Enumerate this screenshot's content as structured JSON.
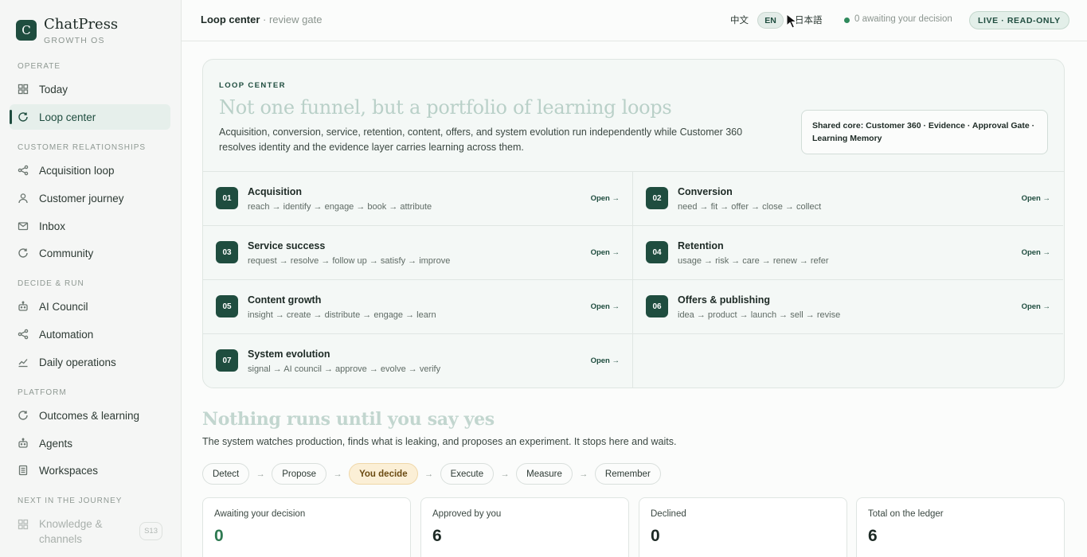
{
  "brand": {
    "logo_letter": "C",
    "name": "ChatPress",
    "sub": "GROWTH OS"
  },
  "sidebar": {
    "sections": [
      {
        "title": "OPERATE"
      },
      {
        "title": "CUSTOMER RELATIONSHIPS"
      },
      {
        "title": "DECIDE & RUN"
      },
      {
        "title": "PLATFORM"
      },
      {
        "title": "NEXT IN THE JOURNEY"
      }
    ],
    "items": [
      {
        "label": "Today",
        "icon": "grid-icon"
      },
      {
        "label": "Loop center",
        "icon": "refresh-icon",
        "active": true
      },
      {
        "label": "Acquisition loop",
        "icon": "share-icon"
      },
      {
        "label": "Customer journey",
        "icon": "user-icon"
      },
      {
        "label": "Inbox",
        "icon": "mail-icon"
      },
      {
        "label": "Community",
        "icon": "refresh-icon"
      },
      {
        "label": "AI Council",
        "icon": "robot-icon"
      },
      {
        "label": "Automation",
        "icon": "share-icon"
      },
      {
        "label": "Daily operations",
        "icon": "trend-icon"
      },
      {
        "label": "Outcomes & learning",
        "icon": "refresh-icon"
      },
      {
        "label": "Agents",
        "icon": "robot-icon"
      },
      {
        "label": "Workspaces",
        "icon": "document-icon"
      },
      {
        "label": "Knowledge & channels",
        "icon": "grid-icon",
        "badge": "S13",
        "disabled": true
      }
    ]
  },
  "topbar": {
    "crumb_title": "Loop center",
    "crumb_sub": " · review gate",
    "lang_zh": "中文",
    "lang_en": "EN",
    "lang_ja": "日本語",
    "status_text": "0 awaiting your decision",
    "mode_pill": "LIVE · READ-ONLY"
  },
  "hero": {
    "eyebrow": "LOOP CENTER",
    "title": "Not one funnel, but a portfolio of learning loops",
    "description": "Acquisition, conversion, service, retention, content, offers, and system evolution run independently while Customer 360 resolves identity and the evidence layer carries learning across them.",
    "core": "Shared core: Customer 360 · Evidence · Approval Gate · Learning Memory",
    "loops": [
      {
        "num": "01",
        "name": "Acquisition",
        "steps": "reach → identify → engage → book → attribute",
        "open": "Open →"
      },
      {
        "num": "02",
        "name": "Conversion",
        "steps": "need → fit → offer → close → collect",
        "open": "Open →"
      },
      {
        "num": "03",
        "name": "Service success",
        "steps": "request → resolve → follow up → satisfy → improve",
        "open": "Open →"
      },
      {
        "num": "04",
        "name": "Retention",
        "steps": "usage → risk → care → renew → refer",
        "open": "Open →"
      },
      {
        "num": "05",
        "name": "Content growth",
        "steps": "insight → create → distribute → engage → learn",
        "open": "Open →"
      },
      {
        "num": "06",
        "name": "Offers & publishing",
        "steps": "idea → product → launch → sell → revise",
        "open": "Open →"
      },
      {
        "num": "07",
        "name": "System evolution",
        "steps": "signal → AI council → approve → evolve → verify",
        "open": "Open →"
      }
    ]
  },
  "gate": {
    "title": "Nothing runs until you say yes",
    "description": "The system watches production, finds what is leaking, and proposes an experiment. It stops here and waits.",
    "steps": [
      "Detect",
      "Propose",
      "You decide",
      "Execute",
      "Measure",
      "Remember"
    ],
    "active_step": "You decide",
    "stats": [
      {
        "label": "Awaiting your decision",
        "value": "0"
      },
      {
        "label": "Approved by you",
        "value": "6"
      },
      {
        "label": "Declined",
        "value": "0"
      },
      {
        "label": "Total on the ledger",
        "value": "6"
      }
    ]
  },
  "colors": {
    "brand": "#1f4d3f",
    "status_green": "#2f8a5c",
    "active_step_bg": "#fbefd6"
  }
}
